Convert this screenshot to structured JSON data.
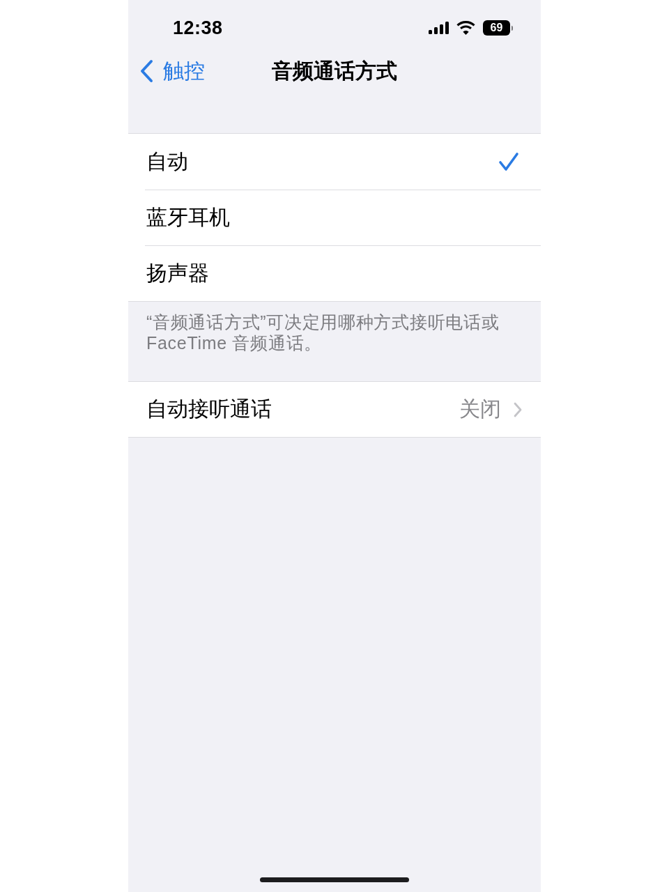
{
  "status_bar": {
    "time": "12:38",
    "battery": "69"
  },
  "nav": {
    "back_label": "触控",
    "title": "音频通话方式"
  },
  "options": [
    {
      "label": "自动",
      "selected": true
    },
    {
      "label": "蓝牙耳机",
      "selected": false
    },
    {
      "label": "扬声器",
      "selected": false
    }
  ],
  "options_footer": "“音频通话方式”可决定用哪种方式接听电话或FaceTime 音频通话。",
  "settings": [
    {
      "label": "自动接听通话",
      "value": "关闭"
    }
  ]
}
